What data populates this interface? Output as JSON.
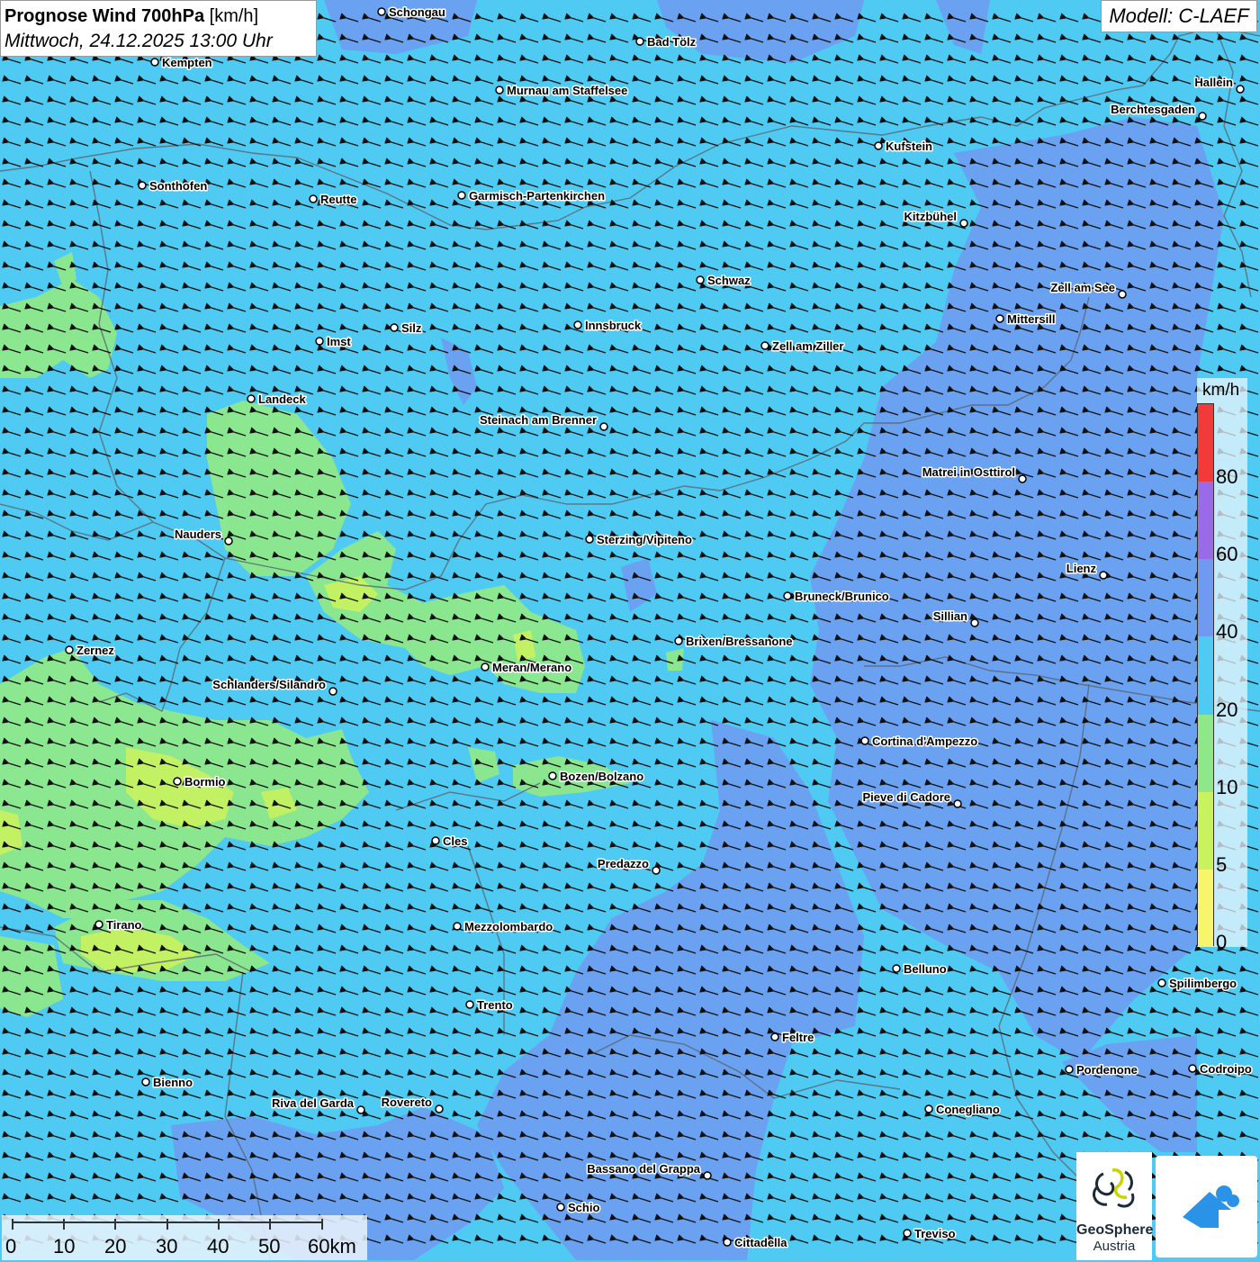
{
  "header": {
    "title_bold": "Prognose Wind 700hPa",
    "title_unit": "[km/h]",
    "subtitle": "Mittwoch, 24.12.2025 13:00 Uhr"
  },
  "model": {
    "label": "Modell: C-LAEF"
  },
  "legend": {
    "unit": "km/h",
    "levels": [
      {
        "label": "0",
        "color": "#f7f56b"
      },
      {
        "label": "5",
        "color": "#c9f25f"
      },
      {
        "label": "10",
        "color": "#8ee88a"
      },
      {
        "label": "20",
        "color": "#4fcaf3"
      },
      {
        "label": "40",
        "color": "#6f9af0"
      },
      {
        "label": "60",
        "color": "#9a6be6"
      },
      {
        "label": "80",
        "color": "#f23a3a"
      }
    ]
  },
  "scale": {
    "labels": [
      "0",
      "10",
      "20",
      "30",
      "40",
      "50",
      "60km"
    ]
  },
  "wind": {
    "general_direction": "from east (arrows pointing west-north-west)"
  },
  "cities": [
    {
      "name": "Schongau"
    },
    {
      "name": "Bad Tölz"
    },
    {
      "name": "Kempten"
    },
    {
      "name": "Murnau am Staffelsee"
    },
    {
      "name": "Hallein"
    },
    {
      "name": "Berchtesgaden"
    },
    {
      "name": "Kufstein"
    },
    {
      "name": "Sonthofen"
    },
    {
      "name": "Reutte"
    },
    {
      "name": "Garmisch-Partenkirchen"
    },
    {
      "name": "Kitzbühel"
    },
    {
      "name": "Schwaz"
    },
    {
      "name": "Zell am See"
    },
    {
      "name": "Mittersill"
    },
    {
      "name": "Silz"
    },
    {
      "name": "Innsbruck"
    },
    {
      "name": "Imst"
    },
    {
      "name": "Zell am Ziller"
    },
    {
      "name": "Landeck"
    },
    {
      "name": "Steinach am Brenner"
    },
    {
      "name": "Matrei in Osttirol"
    },
    {
      "name": "Nauders"
    },
    {
      "name": "Sterzing/Vipiteno"
    },
    {
      "name": "Lienz"
    },
    {
      "name": "Bruneck/Brunico"
    },
    {
      "name": "Sillian"
    },
    {
      "name": "Brixen/Bressanone"
    },
    {
      "name": "Zernez"
    },
    {
      "name": "Meran/Merano"
    },
    {
      "name": "Schlanders/Silandro"
    },
    {
      "name": "Cortina d'Ampezzo"
    },
    {
      "name": "Bozen/Bolzano"
    },
    {
      "name": "Bormio"
    },
    {
      "name": "Pieve di Cadore"
    },
    {
      "name": "Cles"
    },
    {
      "name": "Predazzo"
    },
    {
      "name": "Tirano"
    },
    {
      "name": "Mezzolombardo"
    },
    {
      "name": "Belluno"
    },
    {
      "name": "Spilimbergo"
    },
    {
      "name": "Trento"
    },
    {
      "name": "Feltre"
    },
    {
      "name": "Pordenone"
    },
    {
      "name": "Codroipo"
    },
    {
      "name": "Bienno"
    },
    {
      "name": "Riva del Garda"
    },
    {
      "name": "Rovereto"
    },
    {
      "name": "Conegliano"
    },
    {
      "name": "Bassano del Grappa"
    },
    {
      "name": "Schio"
    },
    {
      "name": "Treviso"
    },
    {
      "name": "Cittadella"
    }
  ],
  "logos": {
    "geosphere_name": "GeoSphere",
    "geosphere_country": "Austria",
    "app_icon": "weather-app-icon"
  }
}
